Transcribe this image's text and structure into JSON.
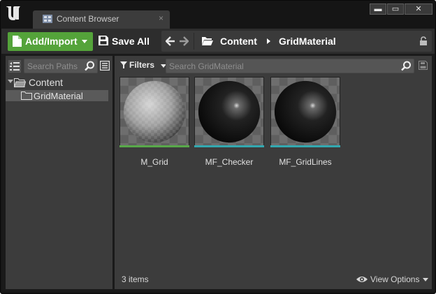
{
  "titlebar": {
    "tab_label": "Content Browser",
    "tab_close": "×",
    "window_buttons": {
      "minimize": "▬",
      "maximize": "▭",
      "close": "✕"
    }
  },
  "toolbar": {
    "add_import_label": "Add/Import",
    "save_all_label": "Save All",
    "breadcrumbs": [
      "Content",
      "GridMaterial"
    ]
  },
  "sources": {
    "search_placeholder": "Search Paths",
    "tree": {
      "root_label": "Content",
      "child_label": "GridMaterial"
    }
  },
  "assets_panel": {
    "filters_label": "Filters",
    "search_placeholder": "Search GridMaterial",
    "assets": [
      {
        "name": "M_Grid",
        "type_color": "#58a84a",
        "sphere": "grey"
      },
      {
        "name": "MF_Checker",
        "type_color": "#32a8b0",
        "sphere": "black"
      },
      {
        "name": "MF_GridLines",
        "type_color": "#32a8b0",
        "sphere": "black"
      }
    ],
    "item_count": "3 items",
    "view_options_label": "View Options"
  },
  "colors": {
    "accent_green": "#54a33a",
    "panel_bg": "#3c3c3c",
    "selected_row": "#5a5a5a"
  }
}
